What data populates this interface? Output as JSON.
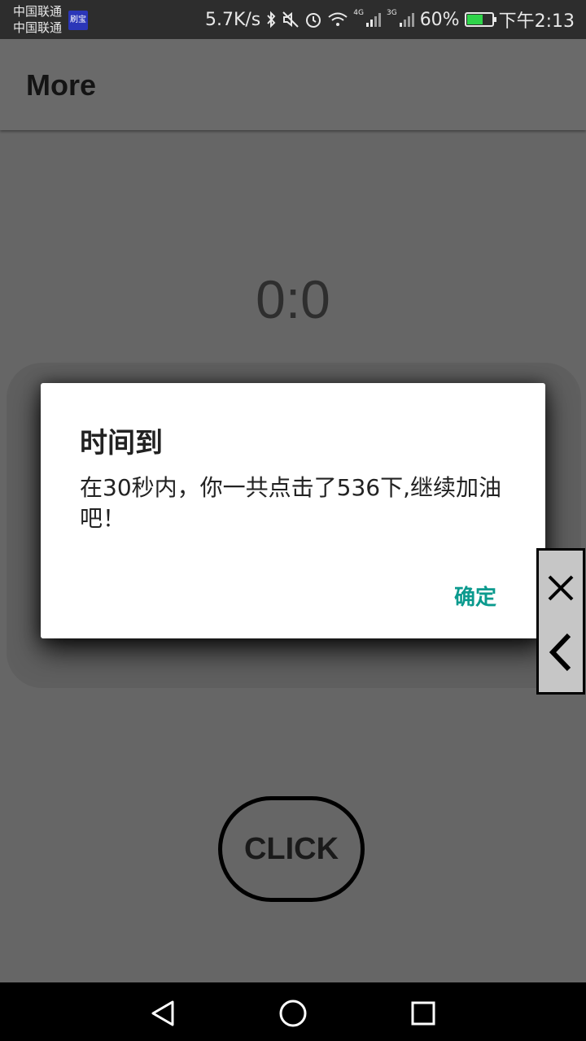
{
  "status_bar": {
    "carrier_1": "中国联通",
    "carrier_2": "中国联通",
    "app_badge": "刷宝",
    "net_speed": "5.7K/s",
    "net_tag_1": "4G",
    "net_tag_2": "3G",
    "battery": "60%",
    "battery_level": 0.6,
    "time": "下午2:13"
  },
  "app_bar": {
    "title": "More"
  },
  "main": {
    "timer": "0:0",
    "click_label": "CLICK"
  },
  "dialog": {
    "title": "时间到",
    "message": "在30秒内，你一共点击了536下,继续加油吧！",
    "confirm_label": "确定"
  },
  "colors": {
    "background": "#666666",
    "dialog_accent": "#0b9a8e"
  }
}
